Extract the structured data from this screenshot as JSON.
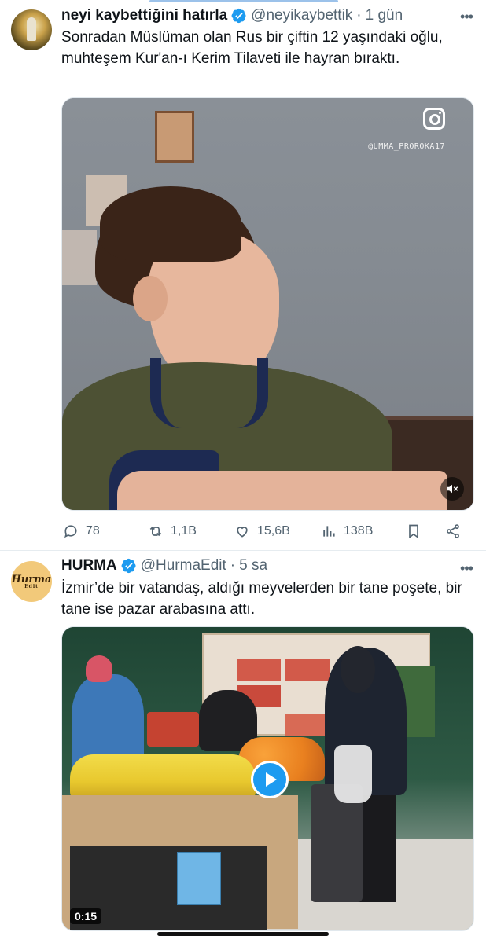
{
  "tweets": [
    {
      "display_name": "neyi kaybettiğini hatırla",
      "handle": "@neyikaybettik",
      "separator": "·",
      "time": "1 gün",
      "text": "Sonradan Müslüman olan Rus bir çiftin 12 yaşındaki oğlu, muhteşem Kur'an-ı Kerim Tilaveti ile hayran bıraktı.",
      "media": {
        "watermark": "@UMMA_PROROKA17"
      },
      "stats": {
        "replies": "78",
        "retweets": "1,1B",
        "likes": "15,6B",
        "views": "138B"
      }
    },
    {
      "display_name": "HURMA",
      "handle": "@HurmaEdit",
      "separator": "·",
      "time": "5 sa",
      "avatar_logo": "Hurma",
      "avatar_logo_sub": "Edit",
      "text": "İzmir’de bir vatandaş, aldığı meyvelerden bir tane poşete, bir tane ise pazar arabasına attı.",
      "media": {
        "duration": "0:15"
      }
    }
  ],
  "icons": {
    "verified": "verified-badge-icon",
    "more": "more-options-icon",
    "reply": "reply-icon",
    "retweet": "retweet-icon",
    "like": "like-icon",
    "views": "views-icon",
    "bookmark": "bookmark-icon",
    "share": "share-icon",
    "instagram": "instagram-icon",
    "mute": "volume-muted-icon",
    "play": "play-icon"
  },
  "colors": {
    "verified": "#1d9bf0",
    "muted_text": "#536471",
    "play_button": "#1d9bf0"
  }
}
